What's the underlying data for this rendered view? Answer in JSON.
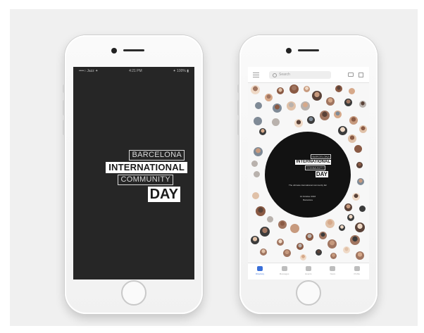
{
  "left_phone": {
    "status_left": "••••○ Jazz ✦",
    "status_center": "4:21 PM",
    "status_right": "✦ 100% ▮",
    "logo": {
      "line1": "BARCELONA",
      "line2": "INTERNATIONAL",
      "line3": "COMMUNITY",
      "line4": "DAY"
    }
  },
  "right_phone": {
    "search_placeholder": "Search",
    "event_logo": {
      "line1": "BARCELONA",
      "line2": "INTERNATIONAL",
      "line3": "COMMUNITY",
      "line4": "DAY"
    },
    "tagline": "The ultimate international community fair",
    "date": "14 October 2016",
    "place": "Barcelona",
    "tabs": [
      {
        "label": "Directory",
        "active": true
      },
      {
        "label": "Messages",
        "active": false
      },
      {
        "label": "Events",
        "active": false
      },
      {
        "label": "News",
        "active": false
      },
      {
        "label": "Profile",
        "active": false
      }
    ],
    "colors": {
      "accent": "#3a6fd8",
      "dark_screen": "#262626",
      "circle": "#121212"
    }
  }
}
